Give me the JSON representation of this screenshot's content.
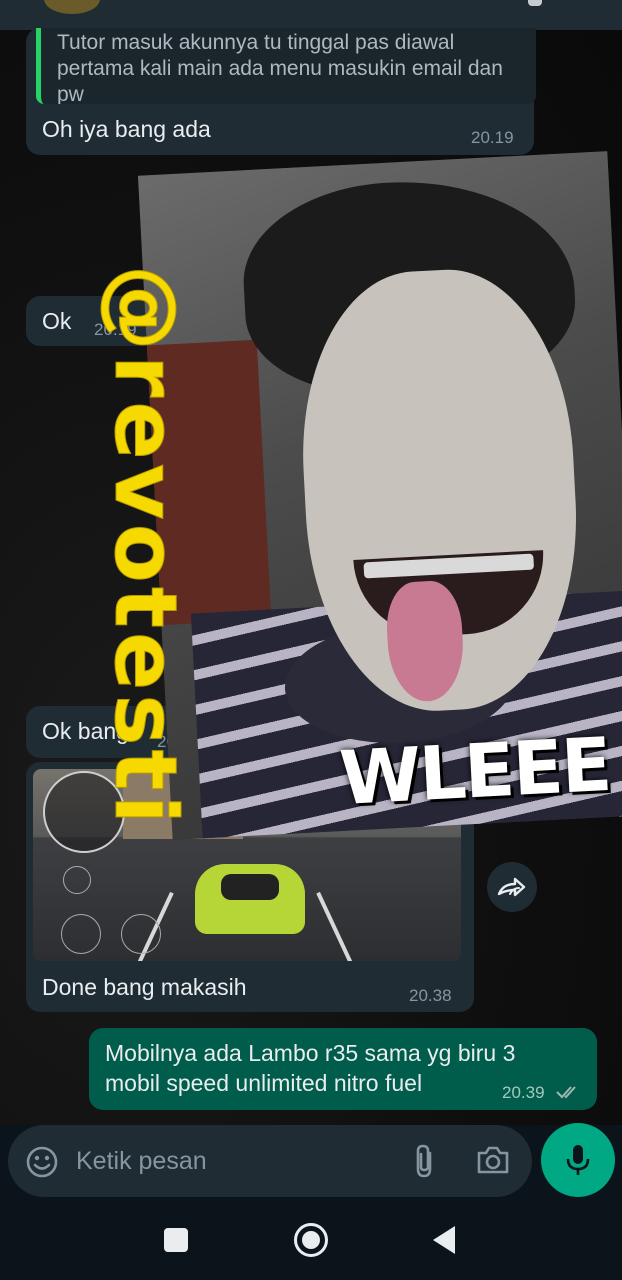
{
  "quoted_message": {
    "text": "Tutor masuk akunnya tu tinggal pas diawal pertama kali main ada menu masukin email dan pw"
  },
  "messages": [
    {
      "id": "m1",
      "direction": "incoming",
      "text": "Oh iya bang ada",
      "time": "20.19"
    },
    {
      "id": "m2",
      "direction": "incoming",
      "text": "Ok",
      "time": "20.19"
    },
    {
      "id": "m3",
      "direction": "incoming",
      "text": "Ok bang",
      "time": "20.3"
    },
    {
      "id": "m4",
      "direction": "incoming",
      "type": "image",
      "caption": "Done bang makasih",
      "time": "20.38"
    },
    {
      "id": "m5",
      "direction": "outgoing",
      "text": "Mobilnya ada Lambo r35 sama yg biru 3 mobil speed unlimited nitro fuel",
      "time": "20.39",
      "status": "read"
    }
  ],
  "sticker": {
    "caption": "WLEEE",
    "watermark": "@revotesti"
  },
  "composer": {
    "placeholder": "Ketik pesan",
    "icons": [
      "emoji-icon",
      "attach-icon",
      "camera-icon",
      "mic-icon"
    ]
  },
  "colors": {
    "incoming_bubble": "#1f2c34",
    "outgoing_bubble": "#005c4b",
    "accent_green": "#00a884",
    "watermark_yellow": "#f5d900"
  }
}
